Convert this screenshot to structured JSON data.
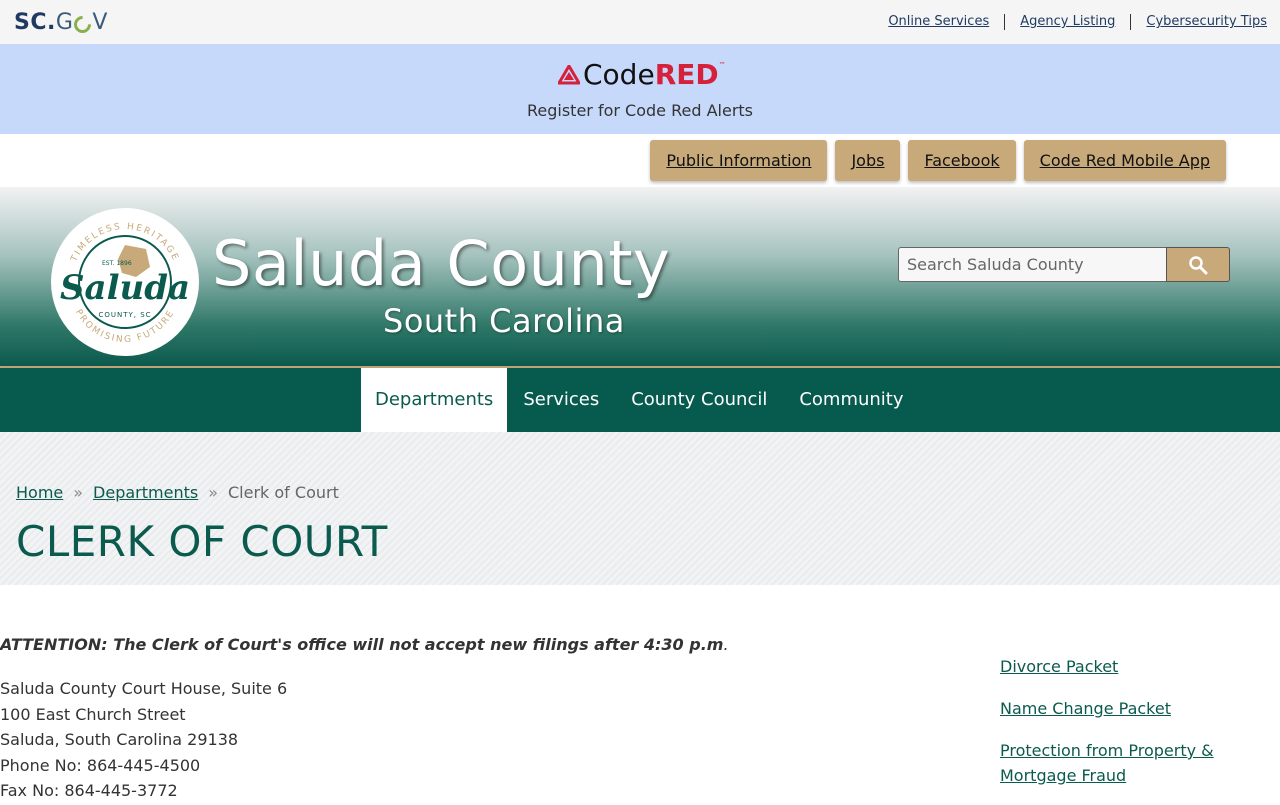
{
  "topbar": {
    "logo_sc": "SC",
    "logo_dot": ".",
    "logo_g": "G",
    "logo_v": "V",
    "links": [
      "Online Services",
      "Agency Listing",
      "Cybersecurity Tips"
    ]
  },
  "codered": {
    "logo_code": "Code",
    "logo_red": "RED",
    "logo_tm": "™",
    "subtitle": "Register for Code Red Alerts"
  },
  "quicklinks": [
    "Public Information",
    "Jobs",
    "Facebook",
    "Code Red Mobile App"
  ],
  "header": {
    "title": "Saluda County",
    "subtitle": "South Carolina",
    "seal": {
      "top_arc": "TIMELESS HERITAGE",
      "bottom_arc": "PROMISING FUTURE",
      "est": "EST. 1896",
      "name": "Saluda",
      "county": "COUNTY, SC"
    },
    "search_placeholder": "Search Saluda County"
  },
  "nav": [
    "Departments",
    "Services",
    "County Council",
    "Community"
  ],
  "breadcrumb": {
    "home": "Home",
    "departments": "Departments",
    "current": "Clerk of Court",
    "separator": "»"
  },
  "page_title": "CLERK OF COURT",
  "content": {
    "attention": "ATTENTION: The Clerk of Court's office will not accept new filings after 4:30 p.m",
    "attention_end": ".",
    "address_lines": [
      "Saluda County Court House, Suite 6",
      "100 East Church Street",
      "Saluda, South Carolina 29138",
      "Phone No: 864-445-4500",
      "Fax No: 864-445-3772"
    ]
  },
  "sidebar_links": [
    "Divorce Packet",
    "Name Change Packet",
    "Protection from Property & Mortgage Fraud"
  ],
  "colors": {
    "green": "#075a4e",
    "gold": "#c8a97a",
    "codered_band": "#c6d9fb",
    "codered_red": "#d6213a"
  }
}
